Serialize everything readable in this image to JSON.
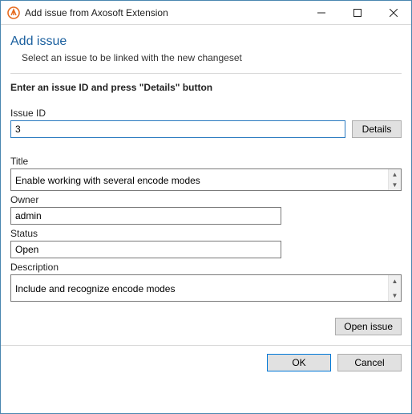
{
  "titlebar": {
    "title": "Add issue from Axosoft Extension"
  },
  "header": {
    "heading": "Add issue",
    "subheading": "Select an issue to be linked with the new changeset"
  },
  "instruction": "Enter an issue ID and press \"Details\" button",
  "issueId": {
    "label": "Issue ID",
    "value": "3",
    "detailsBtn": "Details"
  },
  "fields": {
    "titleLabel": "Title",
    "titleValue": "Enable working with several encode modes",
    "ownerLabel": "Owner",
    "ownerValue": "admin",
    "statusLabel": "Status",
    "statusValue": "Open",
    "descLabel": "Description",
    "descValue": "Include and recognize encode modes"
  },
  "buttons": {
    "openIssue": "Open issue",
    "ok": "OK",
    "cancel": "Cancel"
  }
}
